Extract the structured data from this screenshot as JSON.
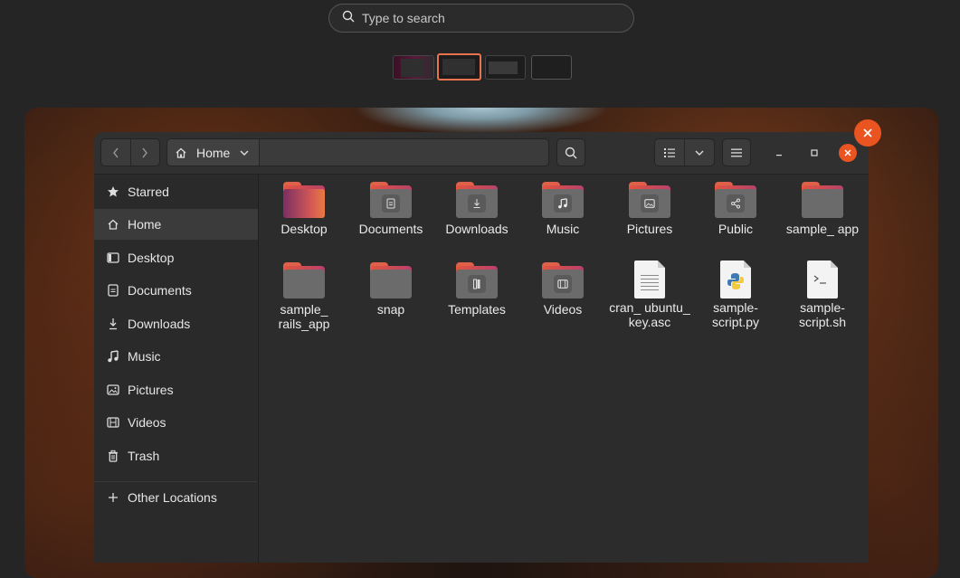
{
  "overview": {
    "search_placeholder": "Type to search"
  },
  "window": {
    "path_label": "Home"
  },
  "sidebar": {
    "items": [
      {
        "label": "Starred",
        "icon": "star-icon"
      },
      {
        "label": "Home",
        "icon": "home-icon",
        "active": true
      },
      {
        "label": "Desktop",
        "icon": "desktop-icon"
      },
      {
        "label": "Documents",
        "icon": "document-icon"
      },
      {
        "label": "Downloads",
        "icon": "download-icon"
      },
      {
        "label": "Music",
        "icon": "music-icon"
      },
      {
        "label": "Pictures",
        "icon": "picture-icon"
      },
      {
        "label": "Videos",
        "icon": "video-icon"
      },
      {
        "label": "Trash",
        "icon": "trash-icon"
      }
    ],
    "other_locations": "Other Locations"
  },
  "files": [
    {
      "label": "Desktop",
      "type": "folder",
      "emblem": "desktop"
    },
    {
      "label": "Documents",
      "type": "folder",
      "emblem": "document"
    },
    {
      "label": "Downloads",
      "type": "folder",
      "emblem": "download"
    },
    {
      "label": "Music",
      "type": "folder",
      "emblem": "music"
    },
    {
      "label": "Pictures",
      "type": "folder",
      "emblem": "picture"
    },
    {
      "label": "Public",
      "type": "folder",
      "emblem": "share"
    },
    {
      "label": "sample_ app",
      "type": "folder",
      "emblem": "none"
    },
    {
      "label": "sample_ rails_app",
      "type": "folder",
      "emblem": "none"
    },
    {
      "label": "snap",
      "type": "folder",
      "emblem": "none"
    },
    {
      "label": "Templates",
      "type": "folder",
      "emblem": "template"
    },
    {
      "label": "Videos",
      "type": "folder",
      "emblem": "video"
    },
    {
      "label": "cran_ ubuntu_ key.asc",
      "type": "text-file"
    },
    {
      "label": "sample- script.py",
      "type": "python-file"
    },
    {
      "label": "sample- script.sh",
      "type": "shell-file"
    }
  ],
  "colors": {
    "accent": "#e95420",
    "selection_border": "#e9734f"
  }
}
